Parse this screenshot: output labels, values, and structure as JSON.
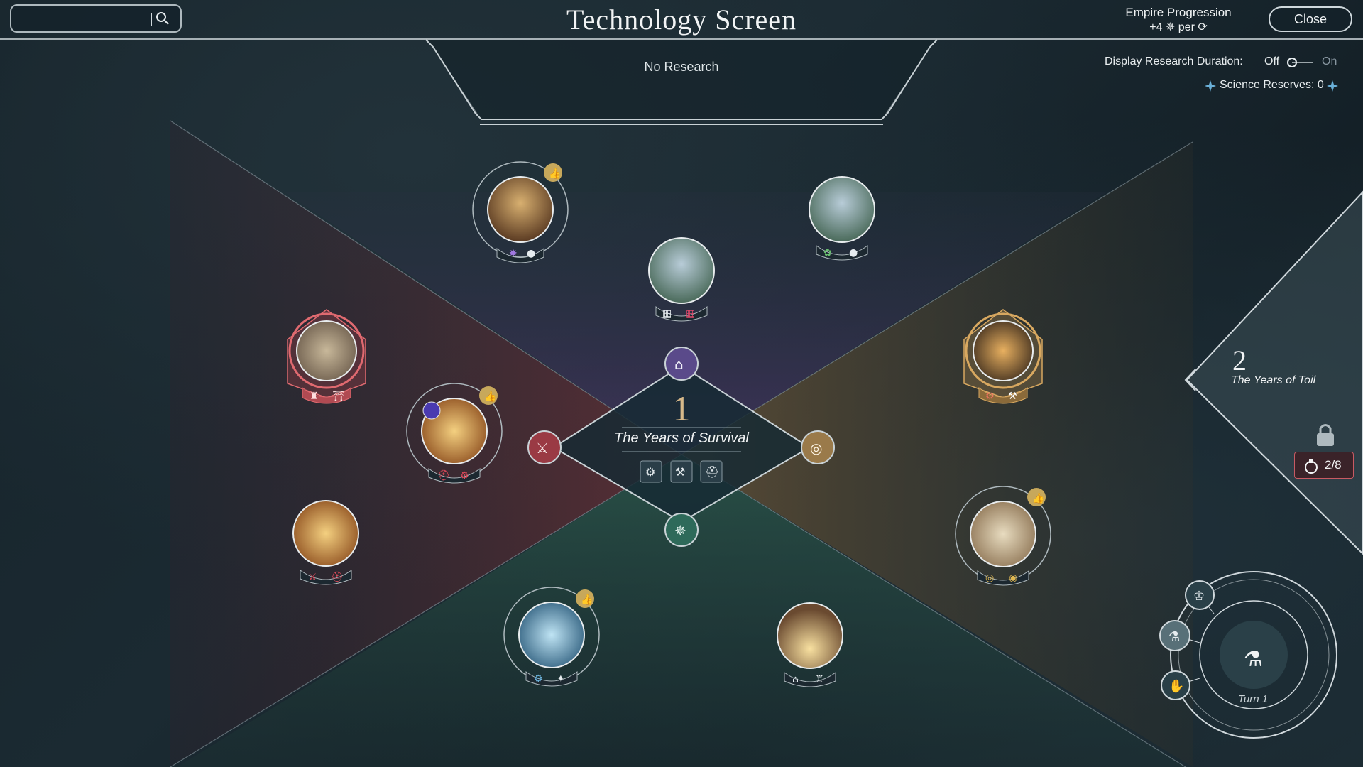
{
  "header": {
    "title": "Technology Screen",
    "research_status": "No Research",
    "search": {
      "placeholder": ""
    },
    "empire_progression": {
      "label": "Empire Progression",
      "value": "+4 ✵ per ⟳"
    },
    "close_label": "Close"
  },
  "options": {
    "display_duration_label": "Display Research Duration:",
    "off_label": "Off",
    "on_label": "On",
    "toggle_state": "off",
    "science_reserves": "Science Reserves: 0"
  },
  "current_era": {
    "number": "1",
    "name": "The Years of Survival"
  },
  "next_era": {
    "number": "2",
    "name": "The Years of Toil",
    "locked": true,
    "progress": "2/8"
  },
  "turn": {
    "label": "Turn 1"
  },
  "colors": {
    "military": "#c0404a",
    "economy": "#c8a060",
    "society": "#7a62b8",
    "science": "#3e8e78",
    "recommended_badge": "#c7a85b",
    "panel_line": "#c9d2d6"
  },
  "tech_nodes": [
    {
      "id": "tech-top-left",
      "quadrant": "society",
      "icons": [
        "star-gear-icon",
        "person-icon"
      ],
      "recommended": true
    },
    {
      "id": "tech-top-center",
      "quadrant": "society",
      "icons": [
        "building-plus-icon",
        "building-icon"
      ],
      "recommended": false
    },
    {
      "id": "tech-top-right",
      "quadrant": "society",
      "icons": [
        "gear-leaf-icon",
        "person-icon"
      ],
      "recommended": false
    },
    {
      "id": "tech-left-wall",
      "quadrant": "military",
      "icons": [
        "fortress-icon",
        "gate-icon"
      ],
      "recommended": false,
      "selected": true
    },
    {
      "id": "tech-left-fire",
      "quadrant": "military",
      "icons": [
        "helmet-plus-icon",
        "gear-icon"
      ],
      "recommended": true
    },
    {
      "id": "tech-left-warrior",
      "quadrant": "military",
      "icons": [
        "sword-icon",
        "helmet-plus-icon"
      ],
      "recommended": false
    },
    {
      "id": "tech-right-smith",
      "quadrant": "economy",
      "icons": [
        "gear-icon",
        "tools-icon"
      ],
      "recommended": false,
      "selected": true
    },
    {
      "id": "tech-right-food",
      "quadrant": "economy",
      "icons": [
        "coin-stack-icon",
        "coin-icon"
      ],
      "recommended": true
    },
    {
      "id": "tech-bottom-left",
      "quadrant": "science",
      "icons": [
        "gear-icon",
        "crystal-icon"
      ],
      "recommended": true
    },
    {
      "id": "tech-bottom-right",
      "quadrant": "science",
      "icons": [
        "gear-house-icon",
        "tower-icon"
      ],
      "recommended": false
    }
  ],
  "era_goals": [
    "magnifier-gear-icon",
    "crossed-tools-icon",
    "helmet-sword-icon"
  ],
  "quadrant_icons": {
    "society": "pillar-building-icon",
    "military": "crossed-swords-icon",
    "economy": "coins-icon",
    "science": "star-compass-icon"
  }
}
